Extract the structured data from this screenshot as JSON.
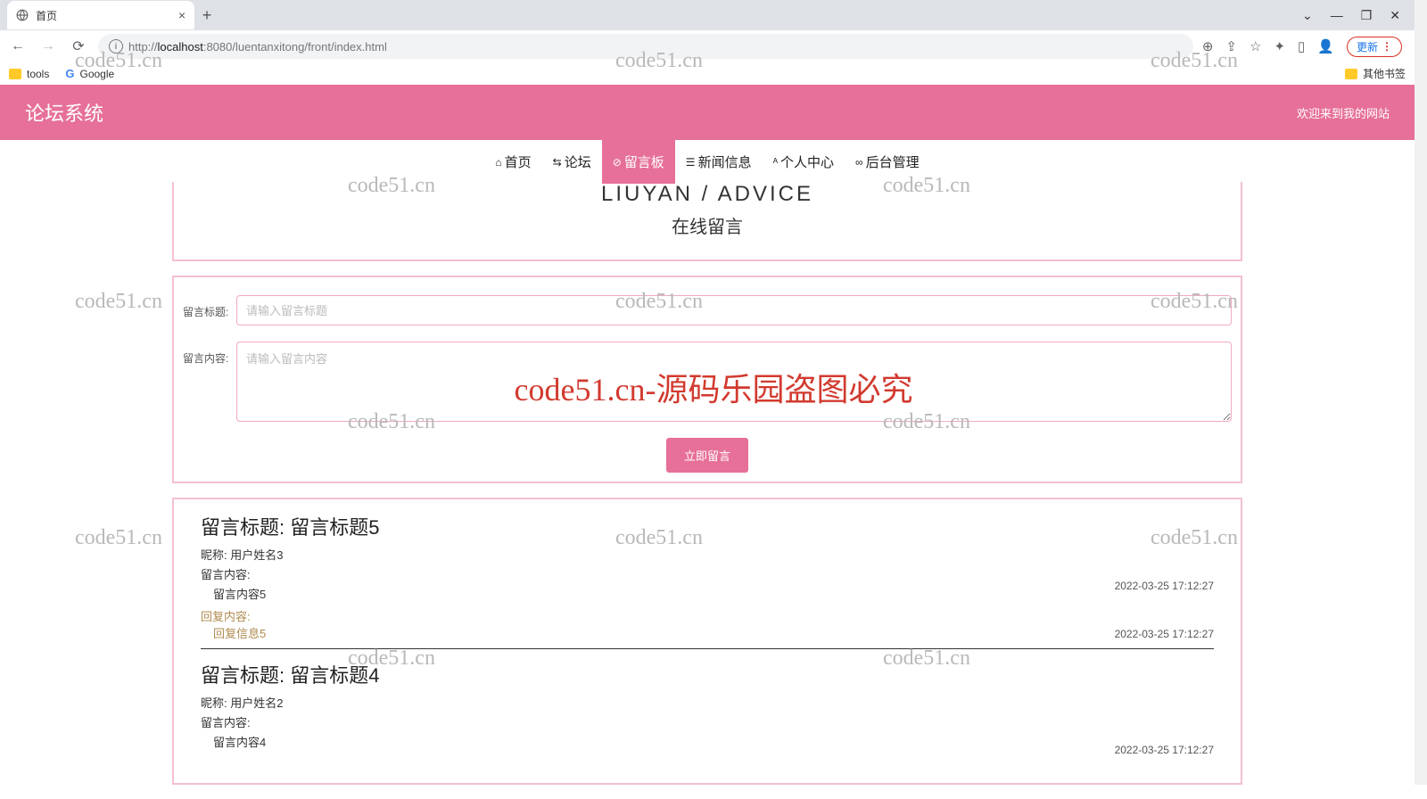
{
  "browser": {
    "tab_title": "首页",
    "url_host": "localhost",
    "url_port": ":8080",
    "url_path": "/luentanxitong/front/index.html",
    "update_label": "更新"
  },
  "bookmarks": {
    "tools": "tools",
    "google": "Google",
    "other": "其他书签"
  },
  "header": {
    "title": "论坛系统",
    "welcome": "欢迎来到我的网站"
  },
  "nav": {
    "home": "首页",
    "forum": "论坛",
    "message": "留言板",
    "news": "新闻信息",
    "profile": "个人中心",
    "admin": "后台管理"
  },
  "section": {
    "en": "LIUYAN / ADVICE",
    "cn": "在线留言"
  },
  "form": {
    "title_label": "留言标题:",
    "title_placeholder": "请输入留言标题",
    "content_label": "留言内容:",
    "content_placeholder": "请输入留言内容",
    "submit": "立即留言"
  },
  "messages": [
    {
      "title_label": "留言标题:",
      "title_value": "留言标题5",
      "nick_label": "昵称:",
      "nick_value": "用户姓名3",
      "content_label": "留言内容:",
      "content_value": "留言内容5",
      "reply_label": "回复内容:",
      "reply_value": "回复信息5",
      "time1": "2022-03-25 17:12:27",
      "time2": "2022-03-25 17:12:27"
    },
    {
      "title_label": "留言标题:",
      "title_value": "留言标题4",
      "nick_label": "昵称:",
      "nick_value": "用户姓名2",
      "content_label": "留言内容:",
      "content_value": "留言内容4",
      "time1": "2022-03-25 17:12:27"
    }
  ],
  "watermark": {
    "small": "code51.cn",
    "big": "code51.cn-源码乐园盗图必究"
  }
}
